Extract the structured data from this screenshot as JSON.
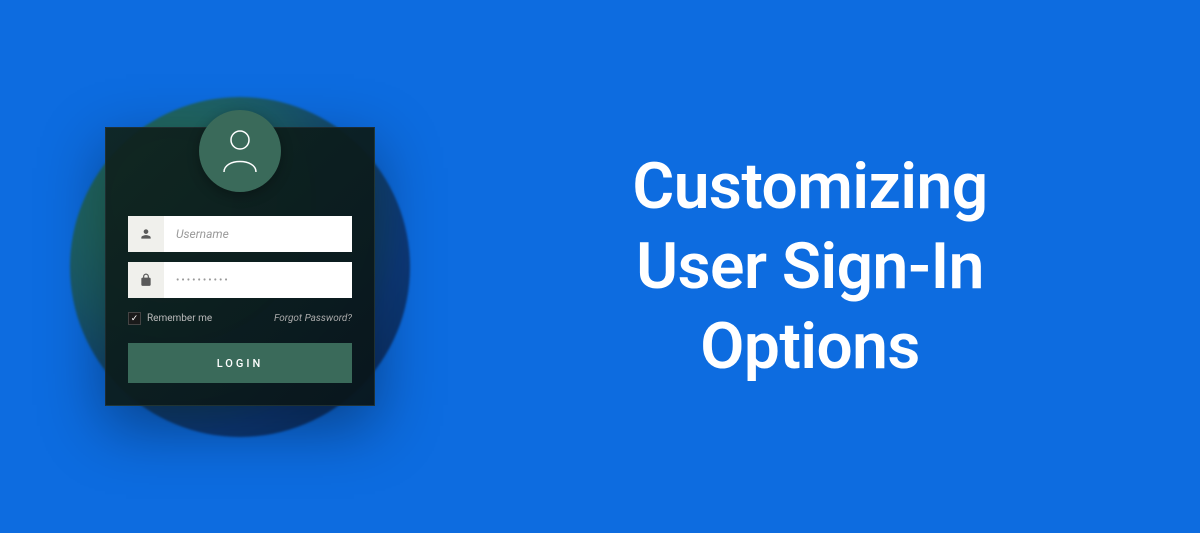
{
  "heading": {
    "line1": "Customizing",
    "line2": "User Sign-In",
    "line3": "Options"
  },
  "login": {
    "username_placeholder": "Username",
    "password_value": "••••••••••",
    "remember_label": "Remember me",
    "forgot_label": "Forgot Password?",
    "button_label": "LOGIN",
    "remember_checked": true
  }
}
